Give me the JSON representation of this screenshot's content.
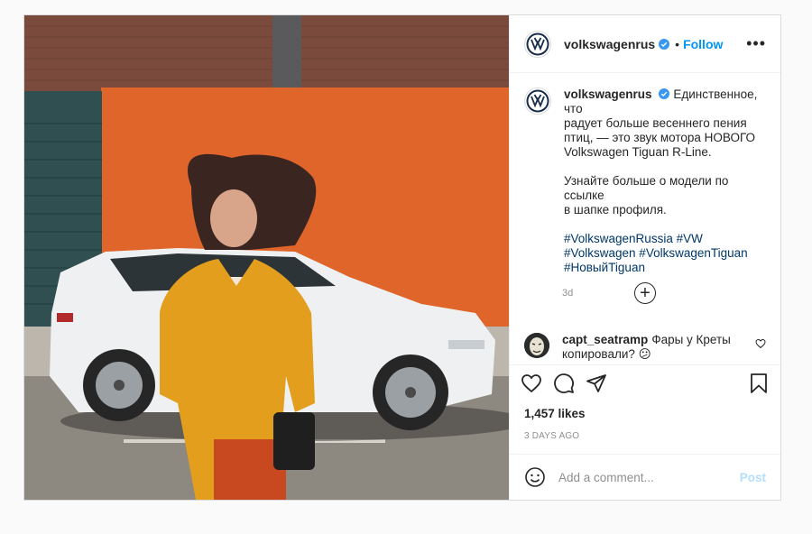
{
  "post": {
    "author": "volkswagenrus",
    "follow_label": "Follow",
    "separator": "•",
    "more_label": "•••",
    "caption": {
      "line1": "Единственное, что",
      "line2": "радует больше весеннего пения",
      "line3": "птиц, — это звук мотора НОВОГО",
      "line4": "Volkswagen Tiguan R-Line.",
      "line5": "Узнайте больше о модели по ссылке",
      "line6": "в шапке профиля.",
      "hashtags_line1": "#VolkswagenRussia #VW",
      "hashtags_line2": "#Volkswagen #VolkswagenTiguan",
      "hashtags_line3": "#НовыйTiguan"
    },
    "caption_age": "3d",
    "load_more": "+",
    "comment": {
      "user": "capt_seatramp",
      "line1": "Фары у Креты",
      "line2": "копировали? 😕"
    },
    "likes": "1,457 likes",
    "date": "3 DAYS AGO",
    "add_comment_placeholder": "Add a comment...",
    "post_label": "Post"
  },
  "icons": {
    "brand_logo": "vw-logo-icon",
    "verified": "verified-badge-icon",
    "like": "heart-icon",
    "comment": "comment-icon",
    "share": "paper-plane-icon",
    "save": "bookmark-icon",
    "emoji": "smiley-icon"
  },
  "colors": {
    "link_blue": "#0095f6",
    "hashtag": "#00376b",
    "muted": "#8e8e8e",
    "border": "#dbdbdb"
  }
}
